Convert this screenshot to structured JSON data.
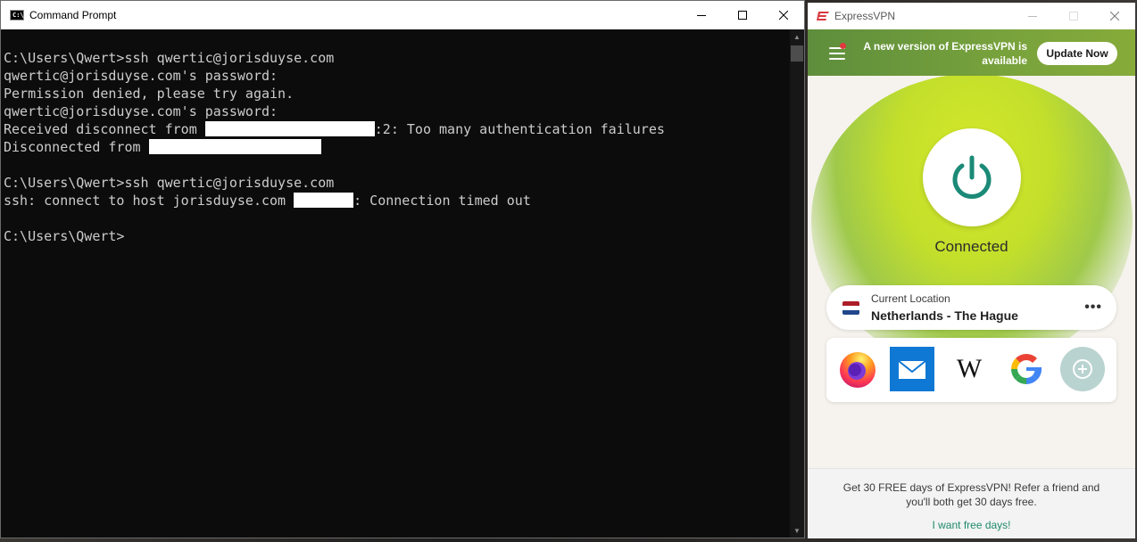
{
  "cmd": {
    "title": "Command Prompt",
    "icon_text": "C:\\",
    "lines": [
      "C:\\Users\\Qwert>ssh qwertic@jorisduyse.com",
      "qwertic@jorisduyse.com's password:",
      "Permission denied, please try again.",
      "qwertic@jorisduyse.com's password:",
      "Received disconnect from ",
      ":2: Too many authentication failures",
      "Disconnected from ",
      "C:\\Users\\Qwert>ssh qwertic@jorisduyse.com",
      "ssh: connect to host jorisduyse.com ",
      ": Connection timed out",
      "C:\\Users\\Qwert>"
    ]
  },
  "vpn": {
    "title": "ExpressVPN",
    "brand_color": "#da3940",
    "update_message": "A new version of ExpressVPN is available",
    "update_button": "Update Now",
    "status": "Connected",
    "location_caption": "Current Location",
    "location_name": "Netherlands - The Hague",
    "more_label": "•••",
    "shortcuts": [
      "firefox-icon",
      "mail-icon",
      "wikipedia-icon",
      "google-icon",
      "add-shortcut-icon"
    ],
    "wikipedia_glyph": "W",
    "footer_text": "Get 30 FREE days of ExpressVPN! Refer a friend and you'll both get 30 days free.",
    "footer_link": "I want free days!"
  }
}
